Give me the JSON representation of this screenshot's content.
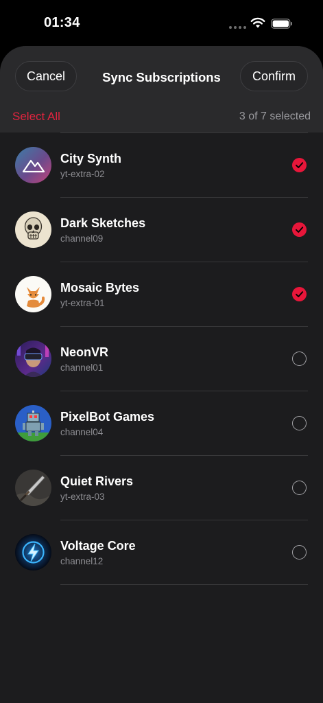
{
  "status_bar": {
    "time": "01:34",
    "icons": [
      "signal-dots-icon",
      "wifi-icon",
      "battery-icon"
    ]
  },
  "header": {
    "cancel_label": "Cancel",
    "title": "Sync Subscriptions",
    "confirm_label": "Confirm",
    "select_all_label": "Select All",
    "selection_summary": "3 of 7 selected"
  },
  "colors": {
    "accent": "#e8163a",
    "sheet_bg": "#1c1c1e",
    "header_bg": "#2a2a2c",
    "secondary_text": "#8e8e93"
  },
  "channels": [
    {
      "name": "City Synth",
      "handle": "yt-extra-02",
      "selected": true,
      "avatar": "mountain-logo-icon"
    },
    {
      "name": "Dark Sketches",
      "handle": "channel09",
      "selected": true,
      "avatar": "skull-sketch-icon"
    },
    {
      "name": "Mosaic Bytes",
      "handle": "yt-extra-01",
      "selected": true,
      "avatar": "fox-illustration-icon"
    },
    {
      "name": "NeonVR",
      "handle": "channel01",
      "selected": false,
      "avatar": "vr-headset-person-icon"
    },
    {
      "name": "PixelBot Games",
      "handle": "channel04",
      "selected": false,
      "avatar": "pixel-robot-icon"
    },
    {
      "name": "Quiet Rivers",
      "handle": "yt-extra-03",
      "selected": false,
      "avatar": "sword-icon"
    },
    {
      "name": "Voltage Core",
      "handle": "channel12",
      "selected": false,
      "avatar": "lightning-bolt-icon"
    }
  ]
}
